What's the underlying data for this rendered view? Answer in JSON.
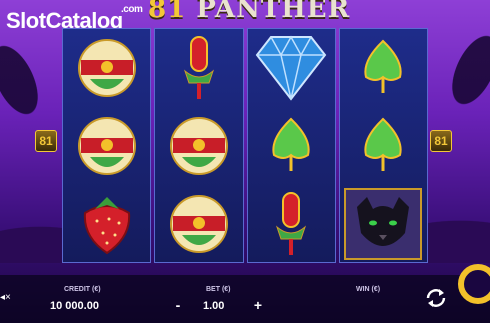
{
  "watermark": {
    "text_slot": "Slot",
    "text_catalog": "Catalog",
    "text_com": ".com"
  },
  "game": {
    "title_number": "81",
    "title_word": "PANTHER"
  },
  "ways_left": "81",
  "ways_right": "81",
  "reels": [
    [
      "flower-bud",
      "flower-bud",
      "strawberry"
    ],
    [
      "popsicle",
      "flower-bud",
      "flower-bud"
    ],
    [
      "diamond",
      "green-leaf",
      "popsicle"
    ],
    [
      "green-leaf",
      "green-leaf",
      "panther"
    ]
  ],
  "bottom": {
    "credit_label": "CREDIT (€)",
    "credit_value": "10 000.00",
    "bet_label": "BET (€)",
    "bet_value": "1.00",
    "bet_minus": "-",
    "bet_plus": "+",
    "win_label": "WIN (€)"
  },
  "colors": {
    "accent": "#f3c12a",
    "reel_bg": "#1a2470",
    "sky": "#8e3fd6"
  }
}
